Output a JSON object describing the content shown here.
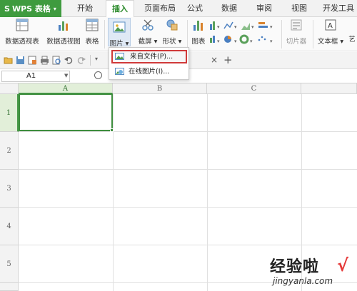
{
  "app": {
    "logo_label": "WPS 表格",
    "accent_color": "#3f9b3f"
  },
  "tabs": [
    {
      "label": "开始"
    },
    {
      "label": "插入"
    },
    {
      "label": "页面布局"
    },
    {
      "label": "公式"
    },
    {
      "label": "数据"
    },
    {
      "label": "审阅"
    },
    {
      "label": "视图"
    },
    {
      "label": "开发工具"
    }
  ],
  "active_tab": "插入",
  "ribbon": {
    "pivot_table": "数据透视表",
    "pivot_chart": "数据透视图",
    "table": "表格",
    "picture": "图片",
    "screenshot": "截屏",
    "shapes": "形状",
    "chart": "图表",
    "slicer": "切片器",
    "textbox": "文本框",
    "art": "艺"
  },
  "menu": {
    "from_file": "来自文件(P)...",
    "online_picture": "在线图片(I)..."
  },
  "formula_bar": {
    "cell_ref": "A1"
  },
  "sheet": {
    "columns": [
      "A",
      "B",
      "C"
    ],
    "rows": [
      "1",
      "2",
      "3",
      "4",
      "5"
    ],
    "selected_cell": "A1"
  },
  "watermark": {
    "title": "经验啦",
    "url": "jingyanla.com",
    "check": "√"
  }
}
